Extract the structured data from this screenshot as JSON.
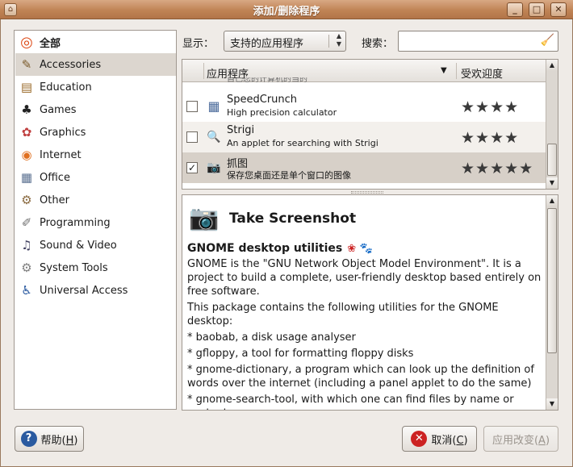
{
  "window": {
    "title": "添加/删除程序",
    "buttons": {
      "minimize": "_",
      "maximize": "□",
      "close": "✕"
    }
  },
  "sidebar": {
    "items": [
      {
        "label": "全部",
        "icon": "ubuntu-logo-icon",
        "glyph": "◎",
        "color": "#dd4814"
      },
      {
        "label": "Accessories",
        "icon": "accessories-icon",
        "glyph": "✎",
        "color": "#7a5a2a"
      },
      {
        "label": "Education",
        "icon": "education-icon",
        "glyph": "▤",
        "color": "#9a6a2a"
      },
      {
        "label": "Games",
        "icon": "games-icon",
        "glyph": "♣",
        "color": "#222222"
      },
      {
        "label": "Graphics",
        "icon": "graphics-icon",
        "glyph": "✿",
        "color": "#c04040"
      },
      {
        "label": "Internet",
        "icon": "internet-icon",
        "glyph": "◉",
        "color": "#e07020"
      },
      {
        "label": "Office",
        "icon": "office-icon",
        "glyph": "▦",
        "color": "#5a7090"
      },
      {
        "label": "Other",
        "icon": "other-icon",
        "glyph": "⚙",
        "color": "#8a6a40"
      },
      {
        "label": "Programming",
        "icon": "programming-icon",
        "glyph": "✐",
        "color": "#707070"
      },
      {
        "label": "Sound & Video",
        "icon": "sound-video-icon",
        "glyph": "♫",
        "color": "#404060"
      },
      {
        "label": "System Tools",
        "icon": "system-tools-icon",
        "glyph": "⚙",
        "color": "#808080"
      },
      {
        "label": "Universal Access",
        "icon": "universal-access-icon",
        "glyph": "♿",
        "color": "#2a5aa0"
      }
    ]
  },
  "filter": {
    "show_label": "显示：",
    "show_value": "支持的应用程序",
    "search_label": "搜索：",
    "search_value": ""
  },
  "applist": {
    "col_app": "应用程序",
    "col_popularity": "受欢迎度",
    "partial_text": "自己您的计算机的当的",
    "rows": [
      {
        "name": "SpeedCrunch",
        "desc": "High precision calculator",
        "checked": false,
        "stars": "★★★★",
        "icon": "calculator-icon",
        "glyph": "▦"
      },
      {
        "name": "Strigi",
        "desc": "An applet for searching with Strigi",
        "checked": false,
        "stars": "★★★★",
        "icon": "strigi-search-icon",
        "glyph": "🔍"
      },
      {
        "name": "抓图",
        "desc": "保存您桌面还是单个窗口的图像",
        "checked": true,
        "stars": "★★★★★",
        "icon": "camera-icon",
        "glyph": "📷"
      }
    ]
  },
  "details": {
    "title": "Take Screenshot",
    "subtitle": "GNOME desktop utilities",
    "paragraphs": [
      "GNOME is the \"GNU Network Object Model Environment\". It is a project to build a complete, user-friendly desktop based entirely on free software.",
      "This package contains the following utilities for the GNOME desktop:",
      "* baobab, a disk usage analyser",
      "* gfloppy, a tool for formatting floppy disks",
      "* gnome-dictionary, a program which can look up the definition of words over the internet (including a panel applet to do the same)",
      "* gnome-search-tool, with which one can find files by name or content"
    ]
  },
  "footer": {
    "help_label": "帮助",
    "help_key": "H",
    "cancel_label": "取消",
    "cancel_key": "C",
    "apply_label": "应用改变",
    "apply_key": "A"
  },
  "colors": {
    "titlebar": "#c08455",
    "selection": "#d7d0c8",
    "help_icon": "#2a5aa0",
    "cancel_icon": "#cc2222"
  }
}
